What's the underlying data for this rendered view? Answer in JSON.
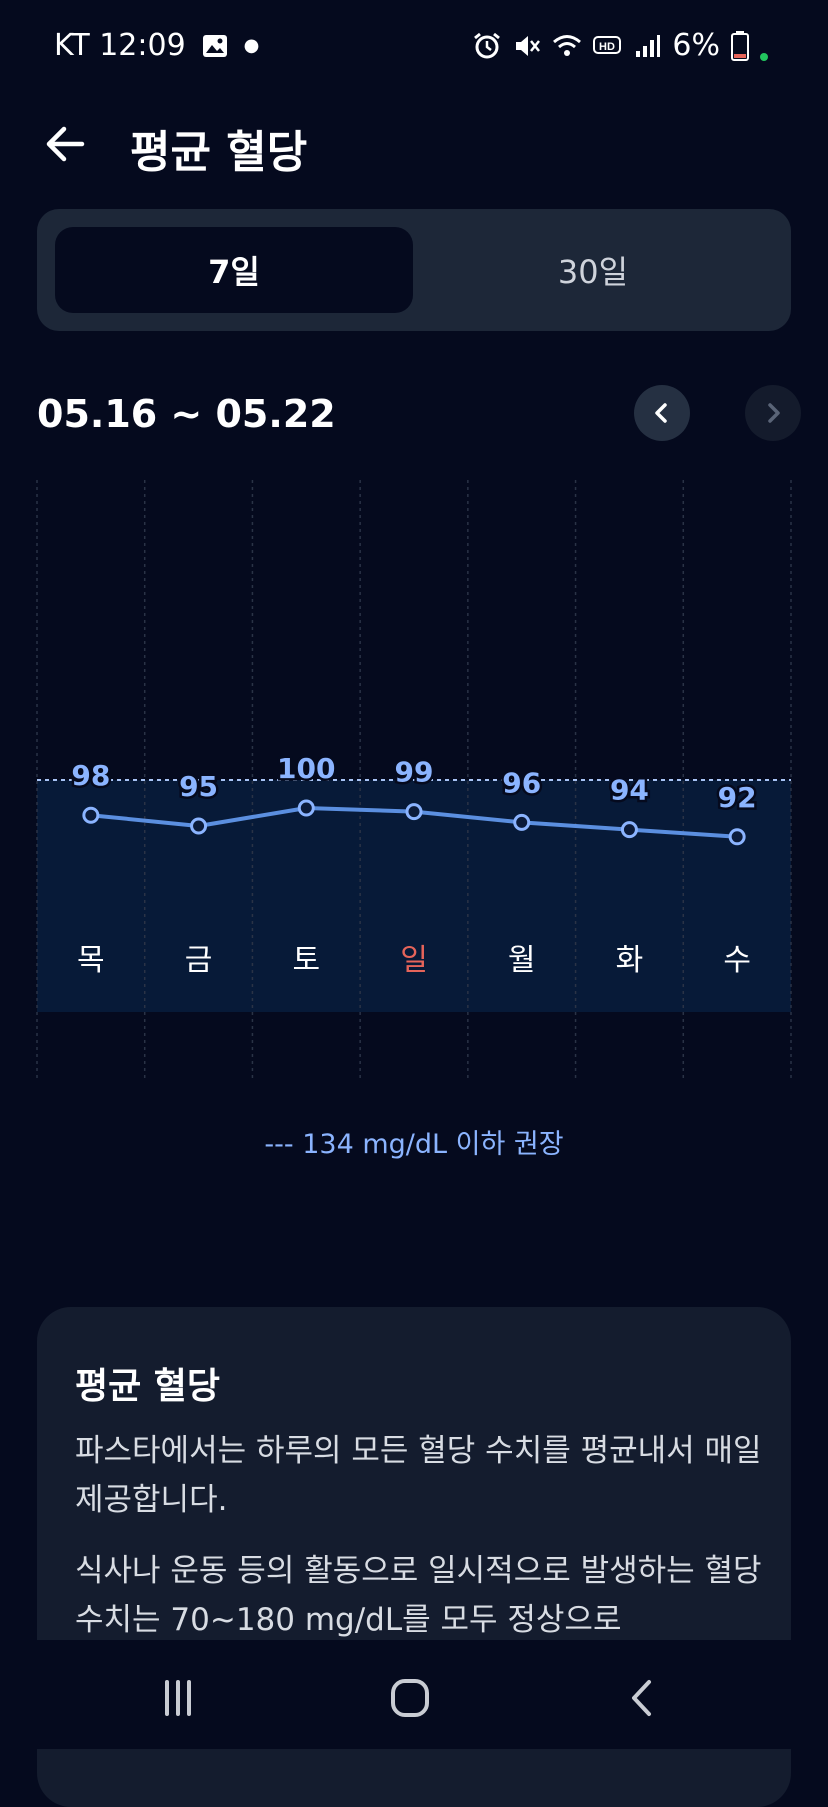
{
  "status_bar": {
    "carrier_time": "KT 12:09",
    "battery": "6%",
    "icons": [
      "gallery-icon",
      "alarm-icon",
      "mute-icon",
      "wifi-icon",
      "hd-voice-icon",
      "signal-icon",
      "battery-icon"
    ]
  },
  "header": {
    "title": "평균 혈당"
  },
  "period_tabs": {
    "tab_7": "7일",
    "tab_30": "30일",
    "selected": "7일"
  },
  "date_range": "05.16 ~ 05.22",
  "chart_data": {
    "type": "line",
    "categories": [
      "목",
      "금",
      "토",
      "일",
      "월",
      "화",
      "수"
    ],
    "values": [
      98,
      95,
      100,
      99,
      96,
      94,
      92
    ],
    "reference_line": 134,
    "legend": "--- 134 mg/dL 이하 권장",
    "colors": {
      "line": "#5b8fe0",
      "band": "#071a38",
      "sunday": "#e5645a",
      "text": "#ffffff"
    }
  },
  "info_card": {
    "title": "평균 혈당",
    "paragraph_1": "파스타에서는 하루의 모든 혈당 수치를 평균내서 매일 제공합니다.",
    "paragraph_2": "식사나 운동 등의 활동으로 일시적으로 발생하는 혈당 수치는 70~180 mg/dL를 모두 정상으로"
  },
  "nav_bar": {
    "icons": [
      "recent-apps-icon",
      "home-icon",
      "back-icon"
    ]
  }
}
